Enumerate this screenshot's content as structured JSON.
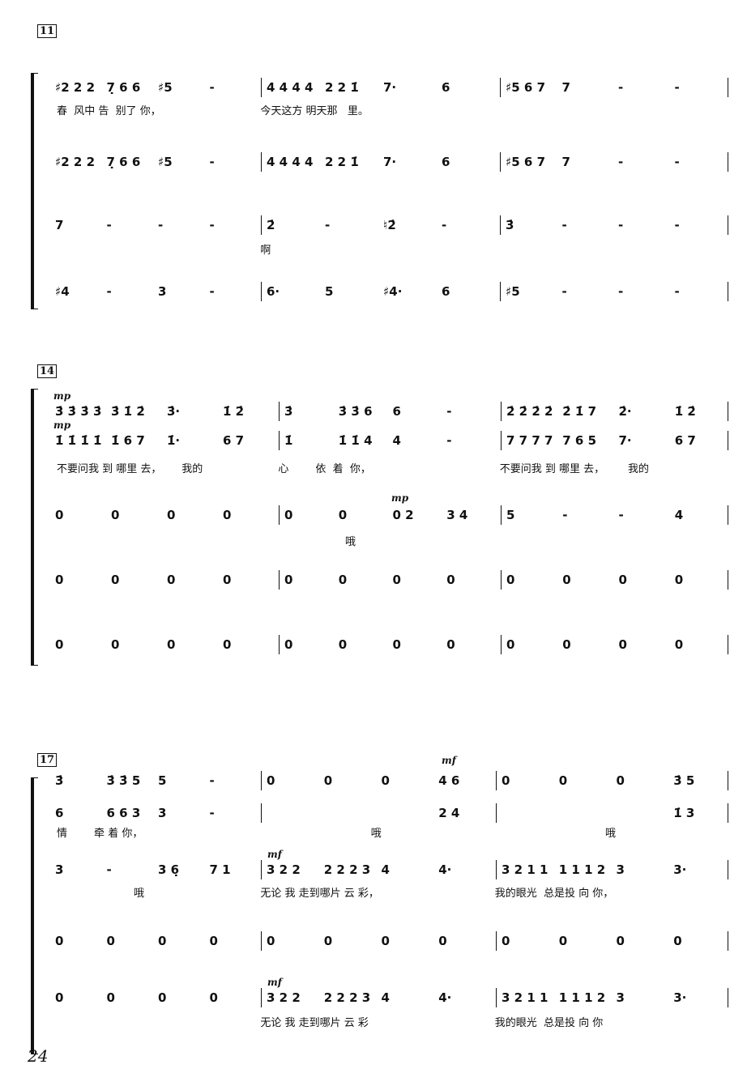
{
  "page_number": "24",
  "systems": [
    {
      "rehearsal_mark": "11",
      "rows": [
        {
          "measures": [
            [
              "♯2 2 2",
              "7̣ 6 6",
              "♯5",
              "-"
            ],
            [
              "4 4 4 4",
              "2 2 1̇",
              "7·",
              "6"
            ],
            [
              "♯5 6 7",
              "7",
              "-",
              "-"
            ]
          ]
        },
        {
          "measures": [
            [
              "♯2 2 2",
              "7̣ 6 6",
              "♯5",
              "-"
            ],
            [
              "4 4 4 4",
              "2 2 1̇",
              "7·",
              "6"
            ],
            [
              "♯5 6 7",
              "7",
              "-",
              "-"
            ]
          ]
        },
        {
          "measures": [
            [
              "7",
              "-",
              "-",
              "-"
            ],
            [
              "2̇",
              "-",
              "♮2̇",
              "-"
            ],
            [
              "3̇",
              "-",
              "-",
              "-"
            ]
          ]
        },
        {
          "measures": [
            [
              "♯4",
              "-",
              "3",
              "-"
            ],
            [
              "6·",
              "5",
              "♯4·",
              "6"
            ],
            [
              "♯5",
              "-",
              "-",
              "-"
            ]
          ]
        }
      ],
      "lyrics": [
        {
          "after_row": 0,
          "parts": [
            "春  风中 告  别了 你，",
            "今天这方 明天那   里。",
            ""
          ]
        },
        {
          "after_row": 2,
          "parts": [
            "",
            "啊",
            ""
          ]
        }
      ]
    },
    {
      "rehearsal_mark": "14",
      "rows": [
        {
          "dynamic": "mp",
          "measures": [
            [
              "3̇ 3̇ 3̇ 3̇",
              "3̇ 1̇ 2̇",
              "3̇·",
              "1̇ 2̇"
            ],
            [
              "3̇",
              "3̇ 3̇ 6",
              "6",
              "-"
            ],
            [
              "2̇ 2̇ 2̇ 2̇",
              "2̇ 1̇ 7",
              "2̇·",
              "1̇ 2̇"
            ]
          ]
        },
        {
          "dynamic": "mp",
          "measures": [
            [
              "1̇ 1̇ 1̇ 1̇",
              "1̇ 6 7",
              "1̇·",
              "6 7"
            ],
            [
              "1̇",
              "1̇ 1̇ 4",
              "4",
              "-"
            ],
            [
              "7 7 7 7",
              "7 6 5",
              "7·",
              "6 7"
            ]
          ]
        },
        {
          "measures": [
            [
              "0",
              "0",
              "0",
              "0"
            ],
            [
              "0",
              "0",
              "0 2",
              "3 4"
            ],
            [
              "5",
              "-",
              "-",
              "4"
            ]
          ]
        },
        {
          "measures": [
            [
              "0",
              "0",
              "0",
              "0"
            ],
            [
              "0",
              "0",
              "0",
              "0"
            ],
            [
              "0",
              "0",
              "0",
              "0"
            ]
          ]
        },
        {
          "measures": [
            [
              "0",
              "0",
              "0",
              "0"
            ],
            [
              "0",
              "0",
              "0",
              "0"
            ],
            [
              "0",
              "0",
              "0",
              "0"
            ]
          ]
        }
      ],
      "lyrics": [
        {
          "after_row": 1,
          "parts": [
            "不要问我 到 哪里 去，      我的",
            "心        依  着  你，",
            "不要问我 到 哪里 去，       我的"
          ]
        },
        {
          "after_row": 2,
          "parts": [
            "",
            "                    哦",
            ""
          ]
        }
      ],
      "extra_dynamic": "mp"
    },
    {
      "rehearsal_mark": "17",
      "rows": [
        {
          "measures": [
            [
              "3̇",
              "3̇ 3̇ 5",
              "5",
              "-"
            ],
            [
              "0",
              "0",
              "0",
              "4 6"
            ],
            [
              "0",
              "0",
              "0",
              "3̇ 5"
            ]
          ]
        },
        {
          "measures": [
            [
              "6",
              "6 6 3",
              "3",
              "-"
            ],
            [
              "",
              "",
              "",
              "2 4"
            ],
            [
              "",
              "",
              "",
              "1̇ 3"
            ]
          ]
        },
        {
          "dynamic": "mf",
          "measures": [
            [
              "3",
              "-",
              "3 6̣",
              "7 1"
            ],
            [
              "3 2 2",
              "2 2 2 3",
              "4",
              "4·"
            ],
            [
              "3 2 1 1",
              "1 1 1 2",
              "3",
              "3·"
            ]
          ]
        },
        {
          "measures": [
            [
              "0",
              "0",
              "0",
              "0"
            ],
            [
              "0",
              "0",
              "0",
              "0"
            ],
            [
              "0",
              "0",
              "0",
              "0"
            ]
          ]
        },
        {
          "dynamic": "mf",
          "measures": [
            [
              "0",
              "0",
              "0",
              "0"
            ],
            [
              "3 2 2",
              "2 2 2 3",
              "4",
              "4·"
            ],
            [
              "3 2 1 1",
              "1 1 1 2",
              "3",
              "3·"
            ]
          ]
        }
      ],
      "lyrics": [
        {
          "after_row": 1,
          "parts": [
            "情        牵 着 你，",
            "                                 哦",
            "                                 哦"
          ]
        },
        {
          "after_row": 2,
          "parts": [
            "                       哦",
            "无论 我 走到哪片 云 彩，",
            "我的眼光  总是投 向 你，"
          ]
        },
        {
          "after_row": 4,
          "parts": [
            "",
            "无论 我 走到哪片 云 彩",
            "我的眼光  总是投 向 你"
          ]
        }
      ],
      "extra_dynamic": "mf"
    }
  ]
}
